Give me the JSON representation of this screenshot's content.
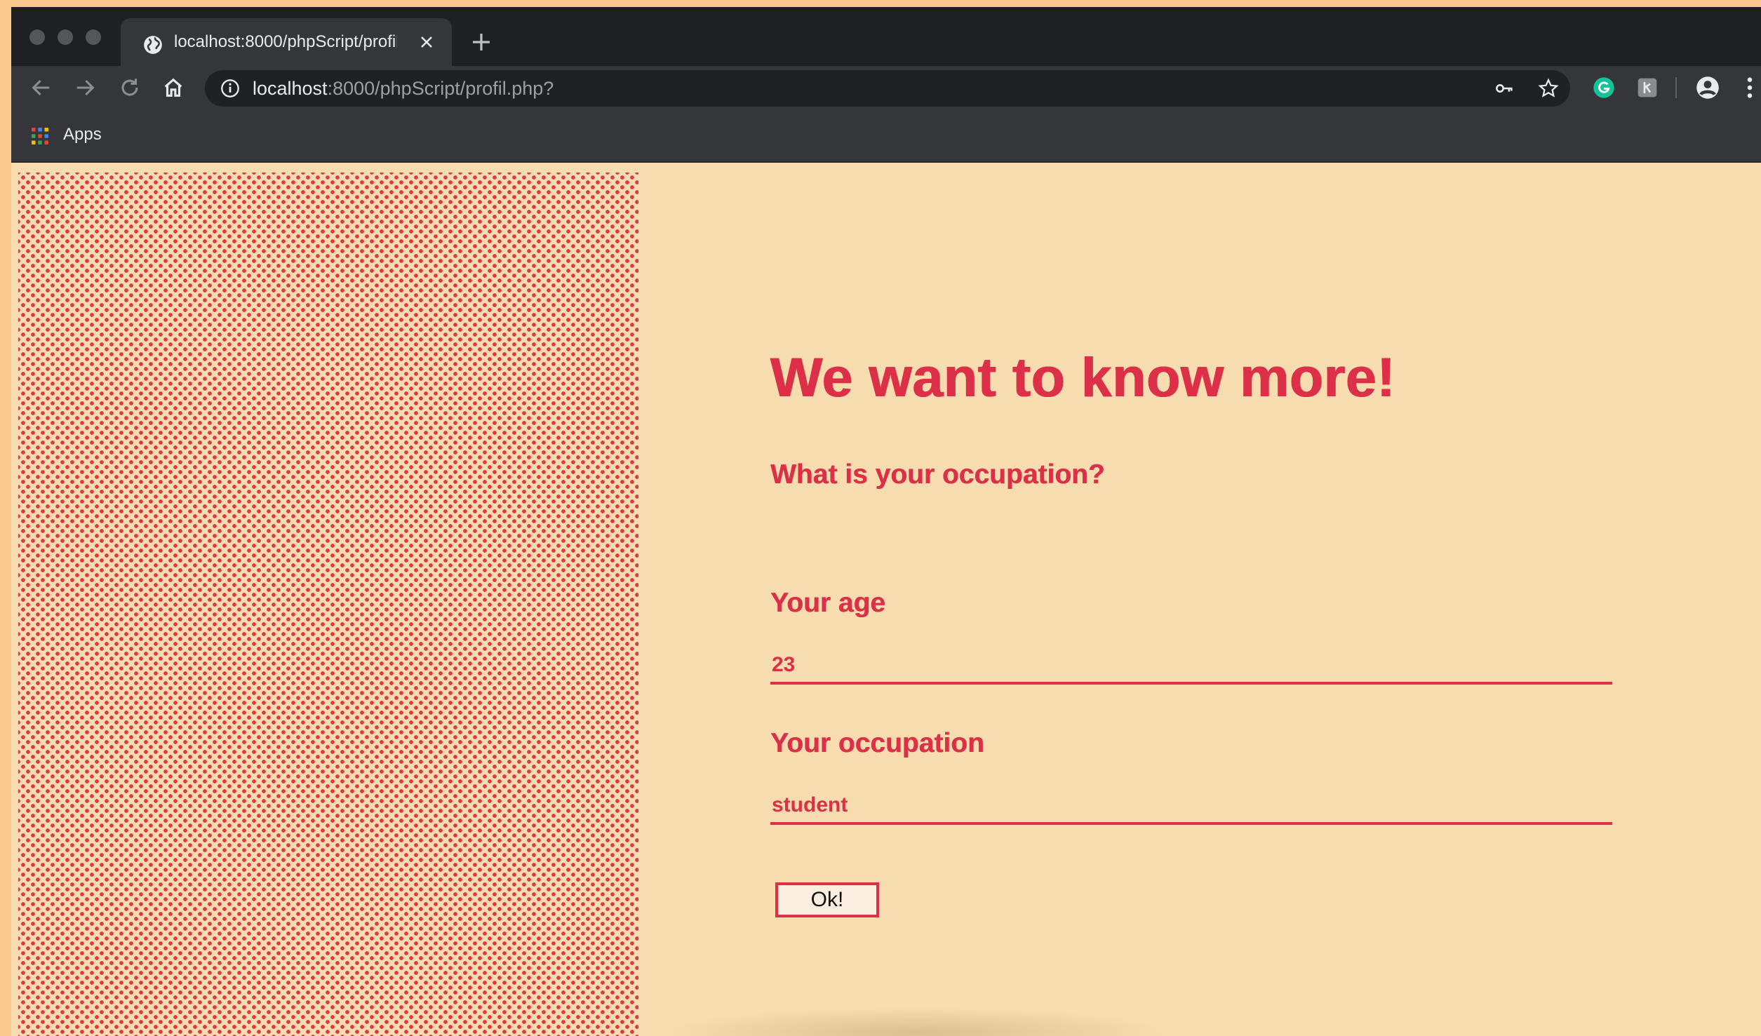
{
  "browser": {
    "tab": {
      "title": "localhost:8000/phpScript/profil.php?",
      "icon": "globe-icon"
    },
    "address_bar": {
      "host": "localhost",
      "path": ":8000/phpScript/profil.php?"
    },
    "bookmarks": {
      "apps_label": "Apps"
    },
    "icons": [
      "back-arrow-icon",
      "forward-arrow-icon",
      "reload-icon",
      "home-icon",
      "info-icon",
      "key-icon",
      "star-icon",
      "grammarly-icon",
      "extension-icon",
      "account-icon",
      "menu-icon"
    ],
    "colors": {
      "chrome_dark": "#1f2023",
      "chrome_toolbar": "#35363a",
      "grammarly": "#15c39a"
    }
  },
  "page": {
    "headline": "We want to know more!",
    "subheading": "What is your occupation?",
    "age": {
      "label": "Your age",
      "value": "23"
    },
    "occupation": {
      "label": "Your occupation",
      "value": "student"
    },
    "submit_label": "Ok!",
    "colors": {
      "background": "#f7dcb0",
      "accent": "#dc2f48"
    }
  }
}
